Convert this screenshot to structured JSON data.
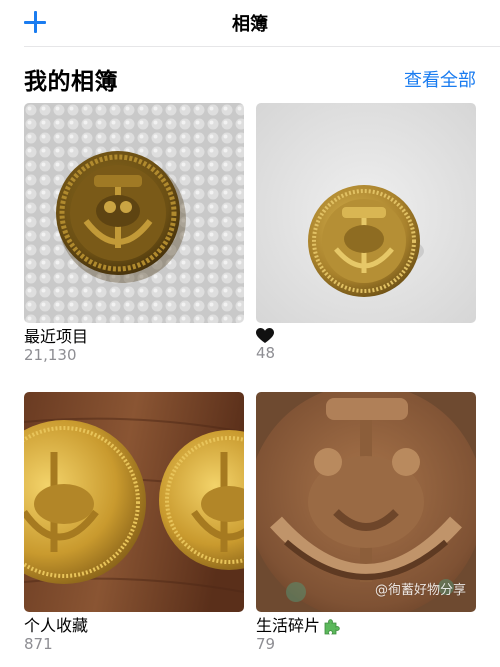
{
  "nav": {
    "title": "相簿"
  },
  "section": {
    "title": "我的相簿",
    "see_all": "查看全部"
  },
  "albums": [
    {
      "name": "最近项目",
      "count": "21,130"
    },
    {
      "name": "",
      "count": "48"
    },
    {
      "name": "个人收藏",
      "count": "871"
    },
    {
      "name": "生活碎片",
      "count": "79"
    }
  ],
  "watermark": "@徇蓄好物分享",
  "icons": {
    "add": "plus-icon",
    "heart": "black-heart-icon",
    "puzzle": "puzzle-piece-icon"
  },
  "colors": {
    "accent": "#1a7cf0",
    "secondary_text": "#8e8e93"
  }
}
